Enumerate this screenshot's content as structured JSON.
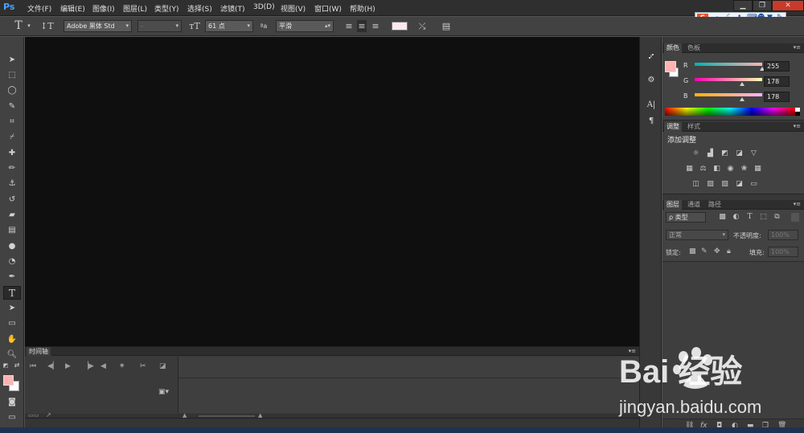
{
  "app": {
    "logo": "Ps"
  },
  "menu": [
    "文件(F)",
    "编辑(E)",
    "图像(I)",
    "图层(L)",
    "类型(Y)",
    "选择(S)",
    "滤镜(T)",
    "3D(D)",
    "视图(V)",
    "窗口(W)",
    "帮助(H)"
  ],
  "ime": {
    "lang": "中"
  },
  "optbar": {
    "type_tool_glyph": "T",
    "font_family": "Adobe 黑体 Std",
    "font_style": "-",
    "font_size": "61 点",
    "antialias_label": "ªa",
    "antialias": "平滑"
  },
  "color_panel": {
    "tabs": [
      "颜色",
      "色板"
    ],
    "fg_color": "#ffb2b2",
    "channels": [
      {
        "label": "R",
        "value": "255",
        "frac": 1.0
      },
      {
        "label": "G",
        "value": "178",
        "frac": 0.698
      },
      {
        "label": "B",
        "value": "178",
        "frac": 0.698
      }
    ]
  },
  "adjust_panel": {
    "tabs": [
      "调整",
      "样式"
    ],
    "heading": "添加调整"
  },
  "layers_panel": {
    "tabs": [
      "图层",
      "通道",
      "路径"
    ],
    "filter_kind": "ρ 类型",
    "blend_mode": "正常",
    "opacity_label": "不透明度:",
    "opacity_value": "100%",
    "lock_label": "锁定:",
    "fill_label": "填充:",
    "fill_value": "100%"
  },
  "timeline": {
    "tab": "时间轴"
  },
  "watermark": {
    "logo": "Bai 经验",
    "url": "jingyan.baidu.com"
  }
}
